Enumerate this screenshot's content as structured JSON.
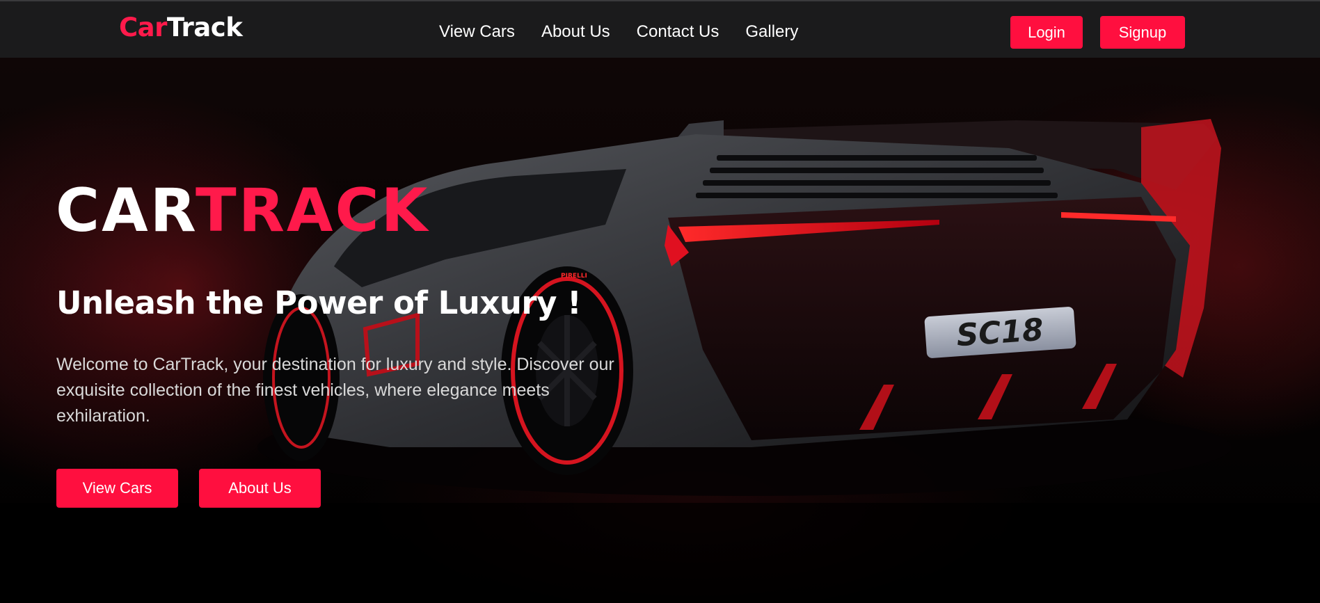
{
  "navbar": {
    "logo": {
      "part1": "Car",
      "part2": "Track"
    },
    "links": [
      "View Cars",
      "About Us",
      "Contact Us",
      "Gallery"
    ],
    "login_label": "Login",
    "signup_label": "Signup"
  },
  "hero": {
    "brand": {
      "part1": "CAR",
      "part2": "TRACK"
    },
    "tagline": "Unleash the Power of Luxury !",
    "intro": "Welcome to CarTrack, your destination for luxury and style. Discover our exquisite collection of the finest vehicles, where elegance meets exhilaration.",
    "buttons": {
      "view_cars": "View Cars",
      "about_us": "About Us"
    },
    "plate_text": "SC18",
    "tire_text": "PIRELLI"
  },
  "colors": {
    "accent": "#ff0f3f",
    "navbar_bg": "#1b1b1c",
    "hero_bg": "#000000"
  },
  "icons": {
    "hero_image": "sports-car-image"
  }
}
